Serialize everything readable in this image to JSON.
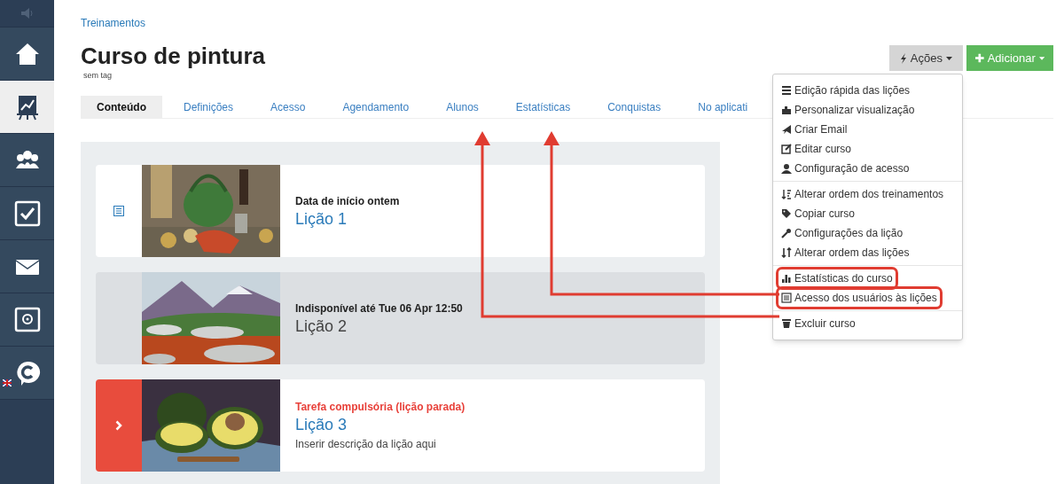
{
  "sidebar": {
    "items": [
      {
        "selected": false
      },
      {
        "selected": true
      },
      {
        "selected": false
      },
      {
        "selected": false
      },
      {
        "selected": false
      },
      {
        "selected": false
      },
      {
        "selected": false
      }
    ]
  },
  "breadcrumb": "Treinamentos",
  "title": "Curso de pintura",
  "tag": "sem tag",
  "actions_button": {
    "label": "Ações"
  },
  "add_button": {
    "label": "Adicionar"
  },
  "tabs": [
    {
      "label": "Conteúdo",
      "selected": true
    },
    {
      "label": "Definições",
      "selected": false
    },
    {
      "label": "Acesso",
      "selected": false
    },
    {
      "label": "Agendamento",
      "selected": false
    },
    {
      "label": "Alunos",
      "selected": false
    },
    {
      "label": "Estatísticas",
      "selected": false
    },
    {
      "label": "Conquistas",
      "selected": false
    },
    {
      "label": "No aplicati",
      "selected": false
    }
  ],
  "lessons": [
    {
      "kind": "available",
      "status": "Data de início ontem",
      "title": "Lição 1"
    },
    {
      "kind": "locked",
      "status": "Indisponível até Tue 06 Apr 12:50",
      "title": "Lição 2"
    },
    {
      "kind": "compulsory",
      "status": "Tarefa compulsória (lição parada)",
      "title": "Lição 3",
      "description": "Inserir descrição da lição aqui"
    }
  ],
  "menu": {
    "groups": [
      [
        {
          "label": "Edição rápida das lições",
          "highlighted": false
        },
        {
          "label": "Personalizar visualização",
          "highlighted": false
        },
        {
          "label": "Criar Email",
          "highlighted": false
        },
        {
          "label": "Editar curso",
          "highlighted": false
        },
        {
          "label": "Configuração de acesso",
          "highlighted": false
        }
      ],
      [
        {
          "label": "Alterar ordem dos treinamentos",
          "highlighted": false
        },
        {
          "label": "Copiar curso",
          "highlighted": false
        },
        {
          "label": "Configurações da lição",
          "highlighted": false
        },
        {
          "label": "Alterar ordem das lições",
          "highlighted": false
        }
      ],
      [
        {
          "label": "Estatísticas do curso",
          "highlighted": true
        },
        {
          "label": "Acesso dos usuários às lições",
          "highlighted": true
        }
      ],
      [
        {
          "label": "Excluir curso",
          "highlighted": false
        }
      ]
    ]
  }
}
